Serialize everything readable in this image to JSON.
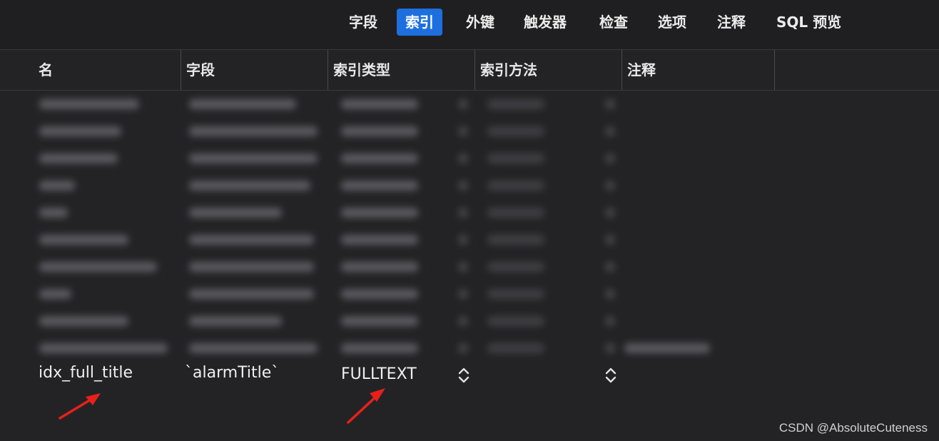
{
  "toolbar": {
    "tabs": [
      {
        "label": "字段",
        "active": false
      },
      {
        "label": "索引",
        "active": true
      },
      {
        "label": "外键",
        "active": false
      },
      {
        "label": "触发器",
        "active": false
      },
      {
        "label": "检查",
        "active": false
      },
      {
        "label": "选项",
        "active": false
      },
      {
        "label": "注释",
        "active": false
      },
      {
        "label": "SQL 预览",
        "active": false
      }
    ],
    "accent_color": "#1d6fe0"
  },
  "table": {
    "columns": [
      "名",
      "字段",
      "索引类型",
      "索引方法",
      "注释"
    ],
    "focused_row": {
      "name": "idx_full_title",
      "field": "`alarmTitle`",
      "index_type": "FULLTEXT"
    }
  },
  "annotation": {
    "arrow_color": "#e8201a"
  },
  "watermark": "CSDN @AbsoluteCuteness"
}
